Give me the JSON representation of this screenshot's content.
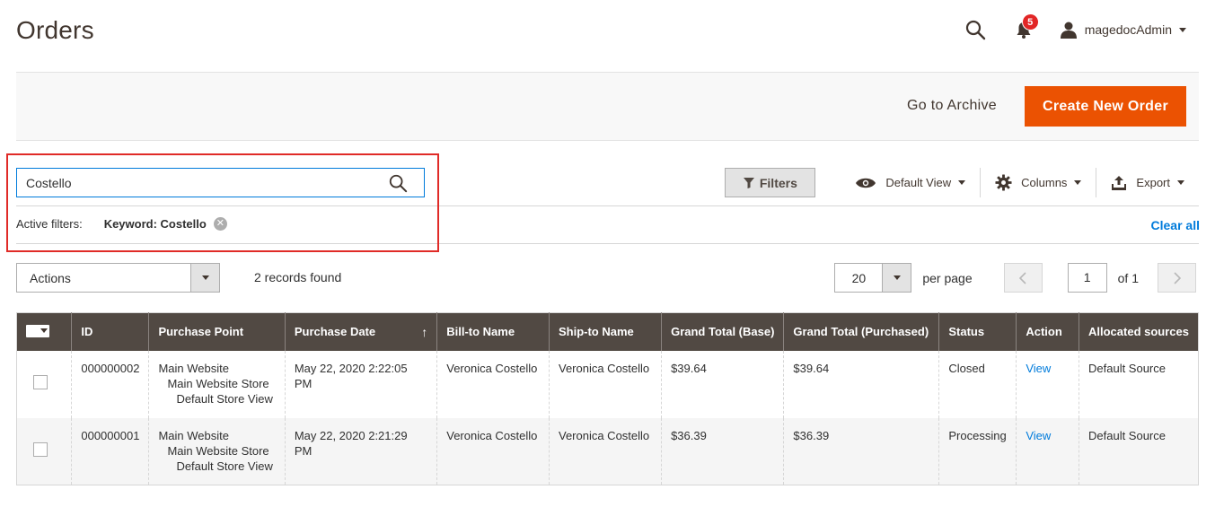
{
  "page": {
    "title": "Orders"
  },
  "header": {
    "notifications_count": "5",
    "user_name": "magedocAdmin"
  },
  "action_bar": {
    "archive_label": "Go to Archive",
    "create_label": "Create New Order"
  },
  "search": {
    "value": "Costello"
  },
  "toolbar": {
    "filters_label": "Filters",
    "view_label": "Default View",
    "columns_label": "Columns",
    "export_label": "Export"
  },
  "active_filters": {
    "label": "Active filters:",
    "keyword": "Keyword: Costello",
    "clear_all": "Clear all"
  },
  "grid_controls": {
    "actions_label": "Actions",
    "records_found": "2 records found",
    "per_page_value": "20",
    "per_page_label": "per page",
    "current_page": "1",
    "of_pages": "of 1"
  },
  "columns": [
    "ID",
    "Purchase Point",
    "Purchase Date",
    "Bill-to Name",
    "Ship-to Name",
    "Grand Total (Base)",
    "Grand Total (Purchased)",
    "Status",
    "Action",
    "Allocated sources"
  ],
  "rows": [
    {
      "id": "000000002",
      "purchase_point": [
        "Main Website",
        "Main Website Store",
        "Default Store View"
      ],
      "purchase_date": "May 22, 2020 2:22:05 PM",
      "bill_to": "Veronica Costello",
      "ship_to": "Veronica Costello",
      "total_base": "$39.64",
      "total_purchased": "$39.64",
      "status": "Closed",
      "action": "View",
      "sources": "Default Source"
    },
    {
      "id": "000000001",
      "purchase_point": [
        "Main Website",
        "Main Website Store",
        "Default Store View"
      ],
      "purchase_date": "May 22, 2020 2:21:29 PM",
      "bill_to": "Veronica Costello",
      "ship_to": "Veronica Costello",
      "total_base": "$36.39",
      "total_purchased": "$36.39",
      "status": "Processing",
      "action": "View",
      "sources": "Default Source"
    }
  ],
  "colors": {
    "accent": "#eb5202",
    "link": "#007bdb",
    "grid_header": "#514943",
    "highlight": "#e02b27",
    "badge": "#e22626"
  }
}
